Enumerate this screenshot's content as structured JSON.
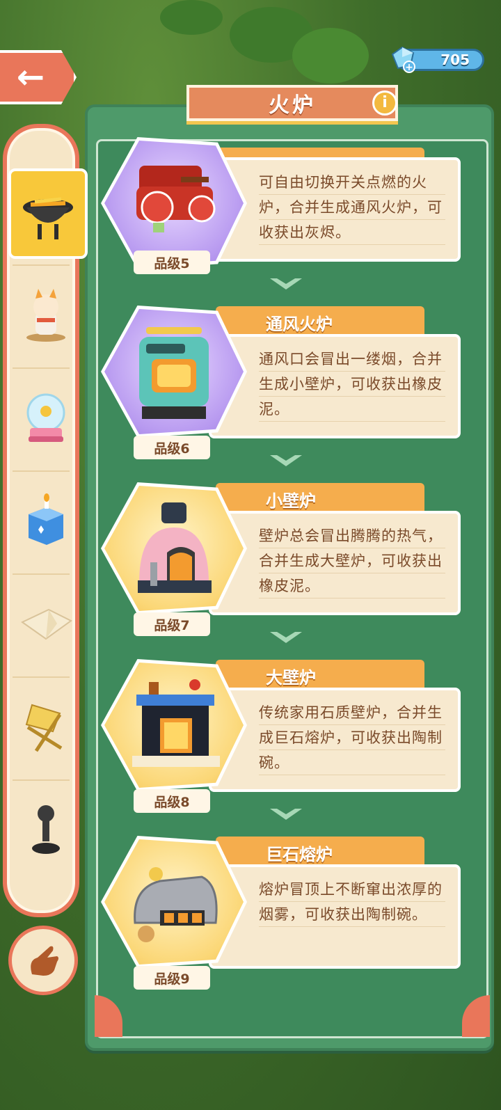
{
  "header": {
    "title": "火炉",
    "gem_count": "705"
  },
  "sidebar": {
    "items": [
      {
        "name": "grill",
        "active": true
      },
      {
        "name": "cat-figure",
        "active": false
      },
      {
        "name": "snow-globe",
        "active": false
      },
      {
        "name": "candle-box",
        "active": false
      },
      {
        "name": "paper",
        "active": false
      },
      {
        "name": "folding-chair",
        "active": false
      },
      {
        "name": "pawn",
        "active": false
      }
    ]
  },
  "cards": [
    {
      "name": "",
      "desc": "可自由切换开关点燃的火炉，合并生成通风火炉，可收获出灰烬。",
      "grade": "品级5"
    },
    {
      "name": "通风火炉",
      "desc": "通风口会冒出一缕烟，合并生成小壁炉，可收获出橡皮泥。",
      "grade": "品级6"
    },
    {
      "name": "小壁炉",
      "desc": "壁炉总会冒出腾腾的热气，合并生成大壁炉，可收获出橡皮泥。",
      "grade": "品级7"
    },
    {
      "name": "大壁炉",
      "desc": "传统家用石质壁炉，合并生成巨石熔炉，可收获出陶制碗。",
      "grade": "品级8"
    },
    {
      "name": "巨石熔炉",
      "desc": "熔炉冒顶上不断窜出浓厚的烟雾，可收获出陶制碗。",
      "grade": "品级9"
    }
  ],
  "colors": {
    "panel": "#4e9a6a",
    "accent": "#e9765a",
    "tab": "#f5ad4d"
  }
}
